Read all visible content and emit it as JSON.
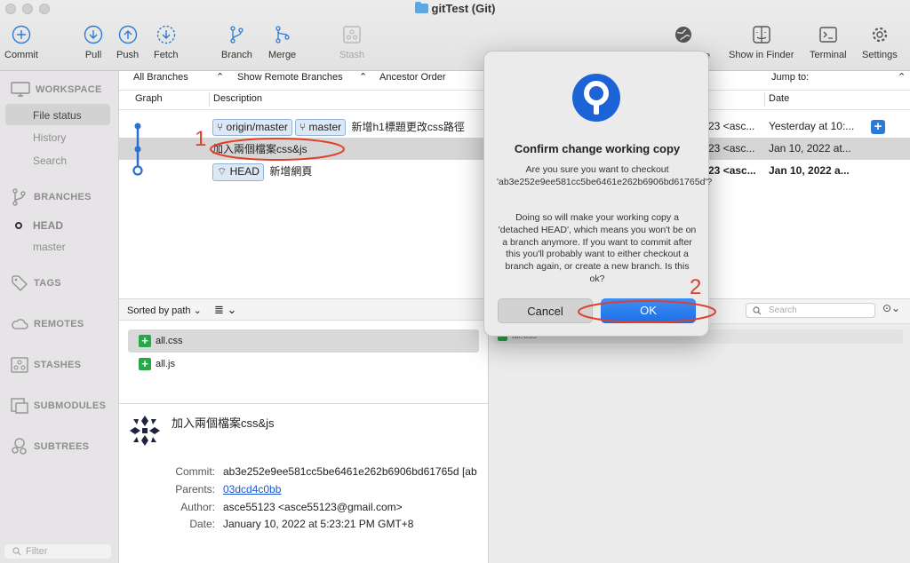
{
  "window": {
    "title": "gitTest (Git)"
  },
  "toolbar": {
    "left": [
      {
        "label": "Commit",
        "icon": "plus-circle-icon"
      },
      {
        "label": "Pull",
        "icon": "arrow-down-circle-icon"
      },
      {
        "label": "Push",
        "icon": "arrow-up-circle-icon"
      },
      {
        "label": "Fetch",
        "icon": "dashed-arrow-down-circle-icon"
      },
      {
        "label": "Branch",
        "icon": "branch-icon"
      },
      {
        "label": "Merge",
        "icon": "merge-icon"
      },
      {
        "label": "Stash",
        "icon": "stash-icon"
      }
    ],
    "right": [
      {
        "label": "e",
        "icon": "globe-icon"
      },
      {
        "label": "Show in Finder",
        "icon": "finder-icon"
      },
      {
        "label": "Terminal",
        "icon": "terminal-icon"
      },
      {
        "label": "Settings",
        "icon": "gear-icon"
      }
    ]
  },
  "sidebar": {
    "workspace": "WORKSPACE",
    "workspace_items": [
      "File status",
      "History",
      "Search"
    ],
    "branches": "BRANCHES",
    "branch_items": [
      "HEAD",
      "master"
    ],
    "tags": "TAGS",
    "remotes": "REMOTES",
    "stashes": "STASHES",
    "submodules": "SUBMODULES",
    "subtrees": "SUBTREES",
    "filter_placeholder": "Filter"
  },
  "filters": {
    "branches": "All Branches",
    "remote": "Show Remote Branches",
    "order": "Ancestor Order",
    "jump": "Jump to:"
  },
  "columns": {
    "graph": "Graph",
    "description": "Description",
    "date": "Date"
  },
  "commits": [
    {
      "tags": [
        "origin/master",
        "master"
      ],
      "message": "新增h1標題更改css路徑",
      "author": "23 <asc...",
      "date": "Yesterday at 10:..."
    },
    {
      "tags": [],
      "message": "加入兩個檔案css&js",
      "author": "23 <asc...",
      "date": "Jan 10, 2022 at..."
    },
    {
      "tags": [
        "HEAD"
      ],
      "message": "新增網頁",
      "author": "23 <asc...",
      "date": "Jan 10, 2022 a..."
    }
  ],
  "files": {
    "sort_label": "Sorted by path",
    "items": [
      "all.css",
      "all.js"
    ]
  },
  "diff": {
    "search_placeholder": "Search",
    "visible_text": "all.css"
  },
  "details": {
    "subject": "加入兩個檔案css&js",
    "commit_label": "Commit:",
    "commit": "ab3e252e9ee581cc5be6461e262b6906bd61765d [ab",
    "parents_label": "Parents:",
    "parents": "03dcd4c0bb",
    "author_label": "Author:",
    "author": "asce55123 <asce55123@gmail.com>",
    "date_label": "Date:",
    "date": "January 10, 2022 at 5:23:21 PM GMT+8"
  },
  "dialog": {
    "title": "Confirm change working copy",
    "message1": "Are you sure you want to checkout 'ab3e252e9ee581cc5be6461e262b6906bd61765d'?",
    "message2": "Doing so will make your working copy a 'detached HEAD', which means you won't be on a branch anymore. If you want to commit after this you'll probably want to either checkout a branch again, or create a new branch. Is this ok?",
    "cancel": "Cancel",
    "ok": "OK"
  },
  "annotations": {
    "one": "1",
    "two": "2"
  },
  "colors": {
    "accent": "#1c6fe5",
    "annotation": "#e0402a",
    "added": "#27a745"
  }
}
